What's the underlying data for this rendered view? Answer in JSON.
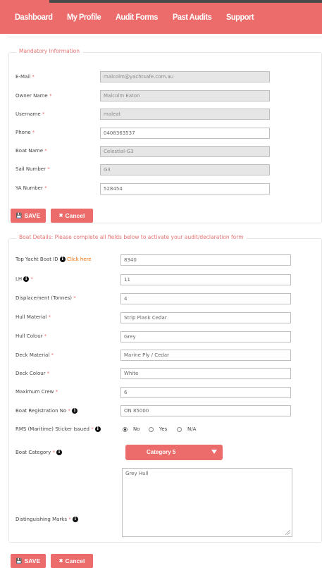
{
  "nav": {
    "items": [
      "Dashboard",
      "My Profile",
      "Audit Forms",
      "Past Audits",
      "Support"
    ]
  },
  "mandatory": {
    "legend": "Mandatory Information",
    "fields": [
      {
        "label": "E-Mail",
        "value": "malcolm@yachtsafe.com.au",
        "disabled": true
      },
      {
        "label": "Owner Name",
        "value": "Malcolm Eaton",
        "disabled": true
      },
      {
        "label": "Username",
        "value": "maleat",
        "disabled": true
      },
      {
        "label": "Phone",
        "value": "0408363537",
        "disabled": false
      },
      {
        "label": "Boat Name",
        "value": "Celestial-G3",
        "disabled": true
      },
      {
        "label": "Sail Number",
        "value": "G3",
        "disabled": true
      },
      {
        "label": "YA Number",
        "value": "528454",
        "disabled": false
      }
    ]
  },
  "buttons": {
    "save_label": "SAVE",
    "cancel_label": "Cancel",
    "save_icon": "floppy-disk-icon",
    "cancel_icon": "x-icon"
  },
  "boat": {
    "legend": "Boat Details: Please complete all fields below to activate your audit/declaration form",
    "top_yacht": {
      "label": "Top Yacht Boat ID",
      "link": "Click here",
      "value": "8340"
    },
    "lh": {
      "label": "LH",
      "value": "11"
    },
    "fields": [
      {
        "label": "Displacement (Tonnes)",
        "value": "4"
      },
      {
        "label": "Hull Material",
        "value": "Strip Plank Cedar"
      },
      {
        "label": "Hull Colour",
        "value": "Grey"
      },
      {
        "label": "Deck Material",
        "value": "Marine Ply / Cedar"
      },
      {
        "label": "Deck Colour",
        "value": "White"
      },
      {
        "label": "Maximum Crew",
        "value": "6"
      }
    ],
    "registration": {
      "label": "Boat Registration No",
      "value": "ON 85000"
    },
    "rms": {
      "label": "RMS (Maritime) Sticker Issued",
      "options": [
        "No",
        "Yes",
        "N/A"
      ],
      "selected": "No"
    },
    "category": {
      "label": "Boat Category",
      "value": "Category 5"
    },
    "marks": {
      "label": "Distinguishing Marks",
      "value": "Grey Hull"
    },
    "required_mark": "*",
    "info_glyph": "i"
  },
  "colors": {
    "accent": "#ec6b6b",
    "legend": "#e57373",
    "link": "#ef6c00"
  }
}
